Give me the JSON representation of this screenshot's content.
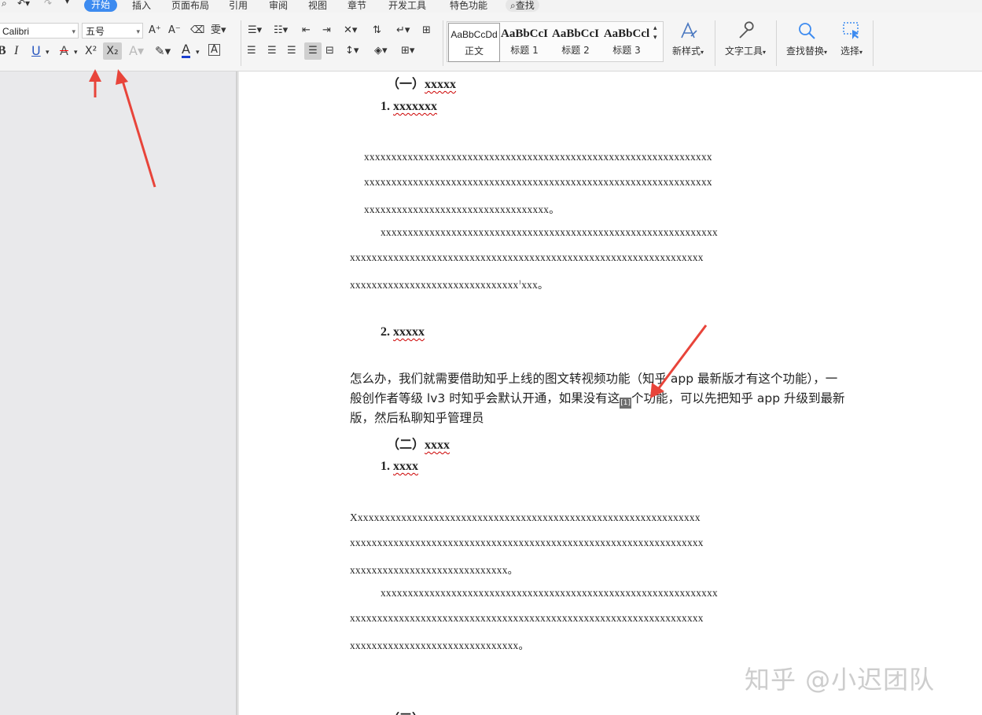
{
  "menu": {
    "tabs": [
      "开始",
      "插入",
      "页面布局",
      "引用",
      "审阅",
      "视图",
      "章节",
      "开发工具",
      "特色功能"
    ],
    "search": "查找"
  },
  "font": {
    "family": "Calibri",
    "size": "五号"
  },
  "styles": [
    {
      "preview": "AaBbCcDd",
      "label": "正文"
    },
    {
      "preview": "AaBbCcI",
      "label": "标题 1"
    },
    {
      "preview": "AaBbCcI",
      "label": "标题 2"
    },
    {
      "preview": "AaBbCcl",
      "label": "标题 3"
    }
  ],
  "tools": {
    "new_style": "新样式",
    "text_tools": "文字工具",
    "find_replace": "查找替换",
    "select": "选择"
  },
  "format_buttons": {
    "bold": "B",
    "italic": "I",
    "underline": "U",
    "superscript": "X²",
    "subscript": "X₂"
  },
  "doc": {
    "h1": "（一）",
    "h1_u": "xxxxx",
    "h1_1": "1. ",
    "h1_1_u": "xxxxxxx",
    "p1a": "xxxxxxxxxxxxxxxxxxxxxxxxxxxxxxxxxxxxxxxxxxxxxxxxxxxxxxxxxxxxxxxx",
    "p1b": "xxxxxxxxxxxxxxxxxxxxxxxxxxxxxxxxxxxxxxxxxxxxxxxxxxxxxxxxxxxxxxxx",
    "p1c": "xxxxxxxxxxxxxxxxxxxxxxxxxxxxxxxxxx。",
    "p2a": "xxxxxxxxxxxxxxxxxxxxxxxxxxxxxxxxxxxxxxxxxxxxxxxxxxxxxxxxxxxxxx",
    "p2b": "xxxxxxxxxxxxxxxxxxxxxxxxxxxxxxxxxxxxxxxxxxxxxxxxxxxxxxxxxxxxxxxxx",
    "p2c": "xxxxxxxxxxxxxxxxxxxxxxxxxxxxxxx",
    "p2c_sup": "1",
    "p2c_end": "xxx。",
    "h1_2": "2. ",
    "h1_2_u": "xxxxx",
    "cn1": "怎么办，我们就需要借助知乎上线的图文转视频功能（知乎 app 最新版才有这个功能），一",
    "cn2a": "般创作者等级 lv3 时知乎会默认开通，如果没有这",
    "cn2_mark": "[1]",
    "cn2b": "个功能，可以先把知乎 app 升级到最新",
    "cn3": "版，然后私聊知乎管理员",
    "h2": "（二）",
    "h2_u": "xxxx",
    "h2_1": "1. ",
    "h2_1_u": "xxxx",
    "p3a": "Xxxxxxxxxxxxxxxxxxxxxxxxxxxxxxxxxxxxxxxxxxxxxxxxxxxxxxxxxxxxxxxx",
    "p3b": "xxxxxxxxxxxxxxxxxxxxxxxxxxxxxxxxxxxxxxxxxxxxxxxxxxxxxxxxxxxxxxxxx",
    "p3c": "xxxxxxxxxxxxxxxxxxxxxxxxxxxxx。",
    "p4a": "xxxxxxxxxxxxxxxxxxxxxxxxxxxxxxxxxxxxxxxxxxxxxxxxxxxxxxxxxxxxxx",
    "p4b": "xxxxxxxxxxxxxxxxxxxxxxxxxxxxxxxxxxxxxxxxxxxxxxxxxxxxxxxxxxxxxxxxx",
    "p4c": "xxxxxxxxxxxxxxxxxxxxxxxxxxxxxxx。"
  },
  "watermark": "知乎 @小迟团队",
  "colors": {
    "accent": "#3d8bf0",
    "arrow": "#e8443a"
  }
}
